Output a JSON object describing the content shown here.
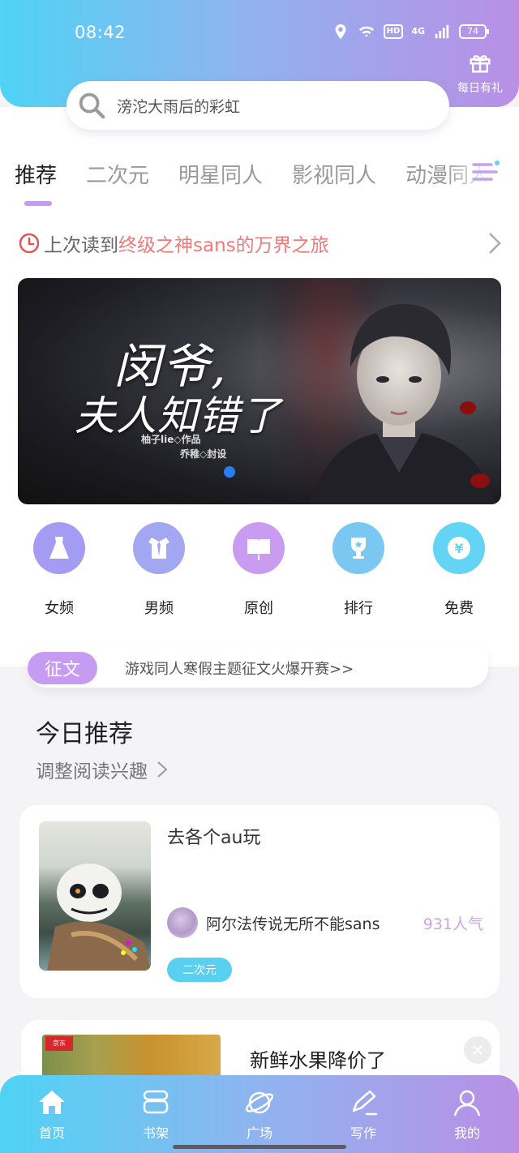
{
  "status_bar": {
    "time": "08:42",
    "hd": "HD",
    "net": "4G",
    "battery": "74"
  },
  "header": {
    "daily_gift": "每日有礼"
  },
  "search": {
    "placeholder": "滂沱大雨后的彩虹"
  },
  "tabs": [
    {
      "label": "推荐",
      "active": true
    },
    {
      "label": "二次元"
    },
    {
      "label": "明星同人"
    },
    {
      "label": "影视同人"
    },
    {
      "label": "动漫同人"
    }
  ],
  "last_read": {
    "prefix": "上次读到",
    "title": "终级之神sans的万界之旅"
  },
  "banner": {
    "title_line1": "闵爷,",
    "title_line2": "夫人知错了",
    "author": "柚子lie◇作品",
    "cover": "乔稚◇封设",
    "active_slide": 1
  },
  "categories": [
    {
      "label": "女频",
      "icon": "dress-icon",
      "color": "#a49cf3"
    },
    {
      "label": "男频",
      "icon": "shirt-icon",
      "color": "#a3a7f2"
    },
    {
      "label": "原创",
      "icon": "book-icon",
      "color": "#c99cf1"
    },
    {
      "label": "排行",
      "icon": "trophy-icon",
      "color": "#7ac8f1"
    },
    {
      "label": "免费",
      "icon": "coin-icon",
      "color": "#64d4f4"
    }
  ],
  "contest": {
    "badge": "征文",
    "text": "游戏同人寒假主题征文火爆开赛>>"
  },
  "today": {
    "title": "今日推荐",
    "subtitle": "调整阅读兴趣"
  },
  "book": {
    "title": "去各个au玩",
    "author": "阿尔法传说无所不能sans",
    "popularity": "931人气",
    "tag": "二次元"
  },
  "ad": {
    "title": "新鲜水果降价了",
    "logo": "京东"
  },
  "bottom_nav": [
    {
      "label": "首页",
      "icon": "home-icon",
      "active": true
    },
    {
      "label": "书架",
      "icon": "bookshelf-icon"
    },
    {
      "label": "广场",
      "icon": "planet-icon"
    },
    {
      "label": "写作",
      "icon": "pen-icon"
    },
    {
      "label": "我的",
      "icon": "user-icon"
    }
  ],
  "colors": {
    "gradient_start": "#4fd3f5",
    "gradient_end": "#b98fe6",
    "accent_purple": "#c39bf0",
    "last_read_highlight": "#ee7a7a",
    "tag_blue": "#59d0ef"
  }
}
